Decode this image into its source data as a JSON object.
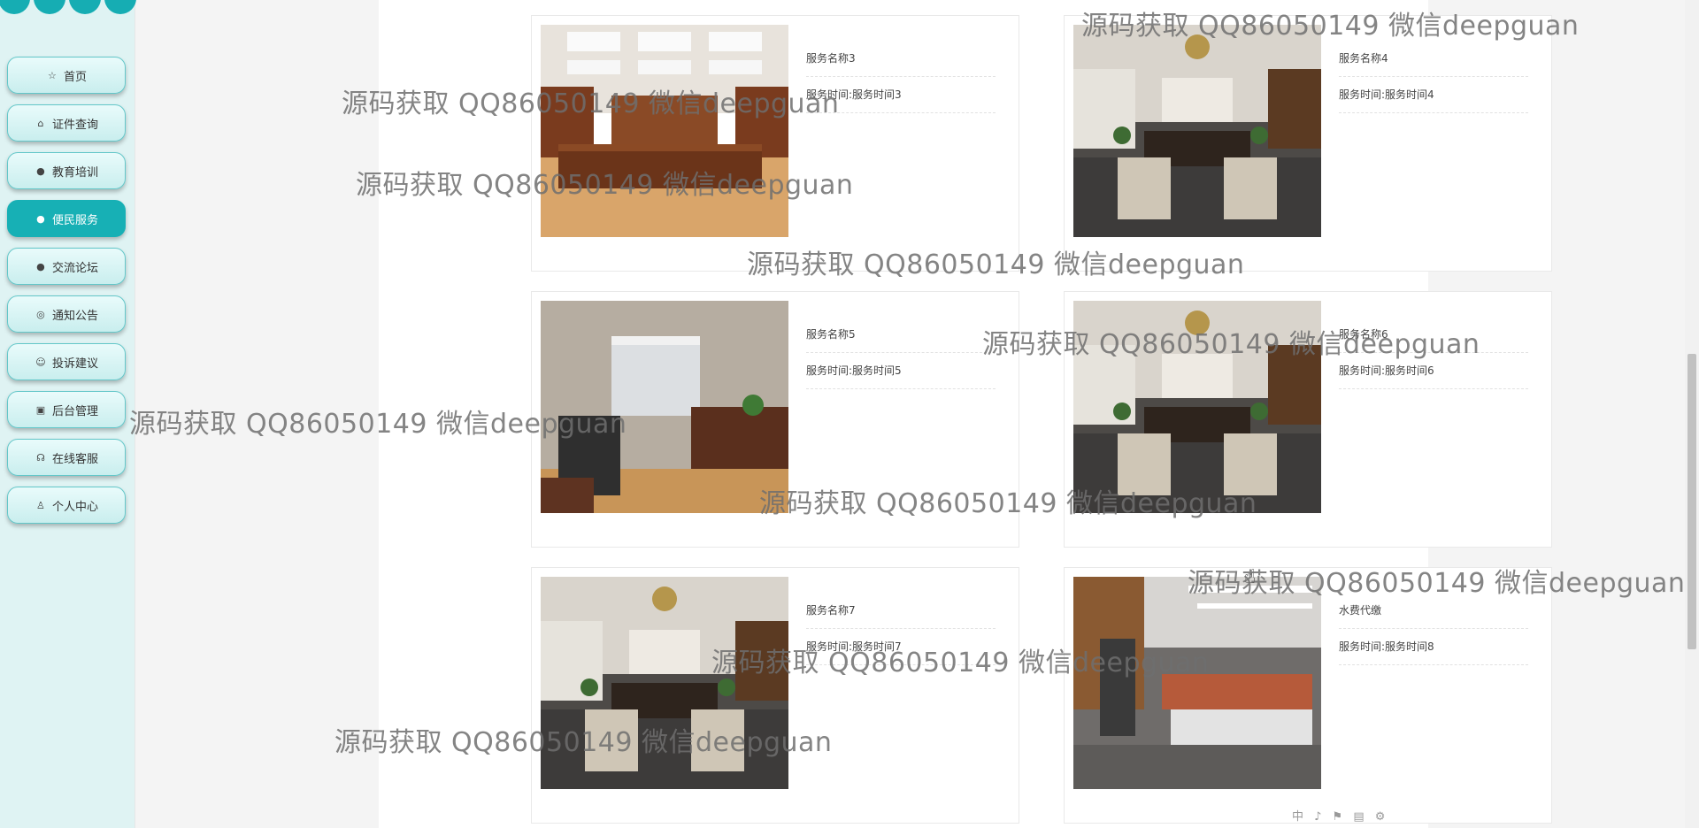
{
  "sidebar": {
    "items": [
      {
        "label": "首页",
        "icon": "star-icon",
        "glyph": "☆"
      },
      {
        "label": "证件查询",
        "icon": "bag-icon",
        "glyph": "⌂"
      },
      {
        "label": "教育培训",
        "icon": "alert-icon",
        "glyph": "●"
      },
      {
        "label": "便民服务",
        "icon": "help-icon",
        "glyph": "●",
        "active": true
      },
      {
        "label": "交流论坛",
        "icon": "info-icon",
        "glyph": "●"
      },
      {
        "label": "通知公告",
        "icon": "bell-icon",
        "glyph": "◎"
      },
      {
        "label": "投诉建议",
        "icon": "smile-icon",
        "glyph": "☺"
      },
      {
        "label": "后台管理",
        "icon": "briefcase-icon",
        "glyph": "▣"
      },
      {
        "label": "在线客服",
        "icon": "headset-icon",
        "glyph": "☊"
      },
      {
        "label": "个人中心",
        "icon": "user-icon",
        "glyph": "♙"
      }
    ]
  },
  "services": [
    {
      "name": "服务名称3",
      "time": "服务时间:服务时间3",
      "image": "executive-office-wood-photo"
    },
    {
      "name": "服务名称4",
      "time": "服务时间:服务时间4",
      "image": "office-chandelier-photo"
    },
    {
      "name": "服务名称5",
      "time": "服务时间:服务时间5",
      "image": "office-window-photo"
    },
    {
      "name": "服务名称6",
      "time": "服务时间:服务时间6",
      "image": "office-chandelier-photo"
    },
    {
      "name": "服务名称7",
      "time": "服务时间:服务时间7",
      "image": "office-chandelier-photo"
    },
    {
      "name": "水费代缴",
      "time": "服务时间:服务时间8",
      "image": "open-office-photo"
    }
  ],
  "watermark_text": "源码获取 QQ86050149 微信deepguan",
  "toolbar_glyphs": "中 ♪ ⚑ ▤ ⚙",
  "colors": {
    "accent": "#17b0b5",
    "sidebar_bg": "#dff3f3"
  }
}
